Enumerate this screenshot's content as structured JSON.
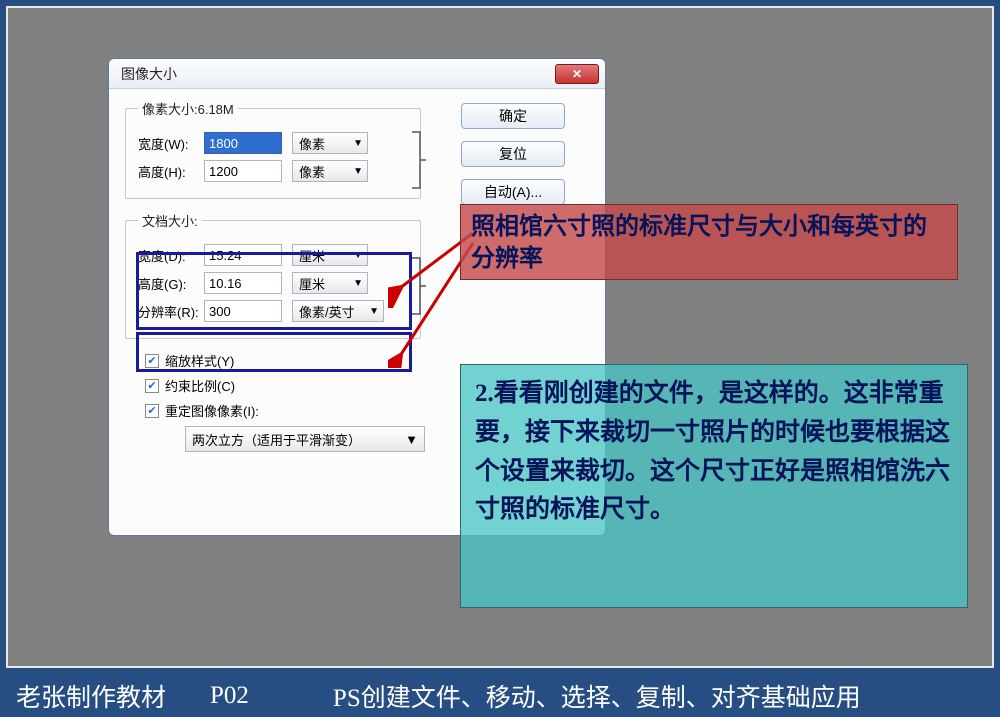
{
  "dialog": {
    "title": "图像大小",
    "closeGlyph": "✕",
    "pixelSection": {
      "legend": "像素大小:6.18M",
      "width": {
        "label": "宽度(W):",
        "value": "1800",
        "unit": "像素"
      },
      "height": {
        "label": "高度(H):",
        "value": "1200",
        "unit": "像素"
      }
    },
    "docSection": {
      "legend": "文档大小:",
      "width": {
        "label": "宽度(D):",
        "value": "15.24",
        "unit": "厘米"
      },
      "height": {
        "label": "高度(G):",
        "value": "10.16",
        "unit": "厘米"
      },
      "resolution": {
        "label": "分辨率(R):",
        "value": "300",
        "unit": "像素/英寸"
      }
    },
    "buttons": {
      "ok": "确定",
      "reset": "复位",
      "auto": "自动(A)..."
    },
    "chk1": "缩放样式(Y)",
    "chk2": "约束比例(C)",
    "chk3": "重定图像像素(I):",
    "interp": "两次立方（适用于平滑渐变）"
  },
  "calloutRed": "照相馆六寸照的标准尺寸与大小和每英寸的分辨率",
  "calloutCyan": "2.看看刚创建的文件，是这样的。这非常重要，接下来裁切一寸照片的时候也要根据这个设置来裁切。这个尺寸正好是照相馆洗六寸照的标准尺寸。",
  "footer": {
    "author": "老张制作教材",
    "page": "P02",
    "title": "PS创建文件、移动、选择、复制、对齐基础应用"
  }
}
